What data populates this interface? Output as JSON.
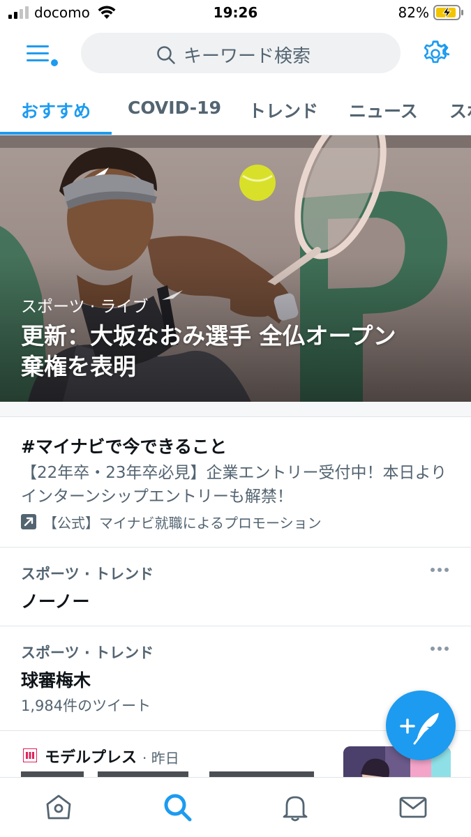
{
  "status_bar": {
    "carrier": "docomo",
    "time": "19:26",
    "battery_percent": "82%"
  },
  "header": {
    "search_placeholder": "キーワード検索"
  },
  "tabs": [
    {
      "label": "おすすめ",
      "active": true
    },
    {
      "label": "COVID-19",
      "active": false
    },
    {
      "label": "トレンド",
      "active": false
    },
    {
      "label": "ニュース",
      "active": false
    },
    {
      "label": "スポ",
      "active": false
    }
  ],
  "hero": {
    "category": "スポーツ · ライブ",
    "title_line1": "更新：大坂なおみ選手 全仏オープン",
    "title_line2": "棄権を表明"
  },
  "promo": {
    "title": "#マイナビで今できること",
    "description": "【22年卒・23年卒必見】企業エントリー受付中！本日よりインターンシップエントリーも解禁！",
    "promoted_label": "【公式】マイナビ就職によるプロモーション"
  },
  "trends": [
    {
      "category": "スポーツ · トレンド",
      "name": "ノーノー",
      "count": ""
    },
    {
      "category": "スポーツ · トレンド",
      "name": "球審梅木",
      "count": "1,984件のツイート"
    }
  ],
  "news": {
    "source": "モデルプレス",
    "time": "· 昨日"
  },
  "colors": {
    "accent": "#1d9bf0",
    "text_primary": "#0f1419",
    "text_secondary": "#536471"
  },
  "icons": {
    "menu": "menu-icon",
    "search": "search-icon",
    "settings": "gear-icon",
    "more": "more-icon",
    "promoted": "promoted-icon",
    "compose": "compose-icon",
    "home": "home-icon",
    "explore": "search-icon",
    "notifications": "bell-icon",
    "messages": "mail-icon"
  }
}
